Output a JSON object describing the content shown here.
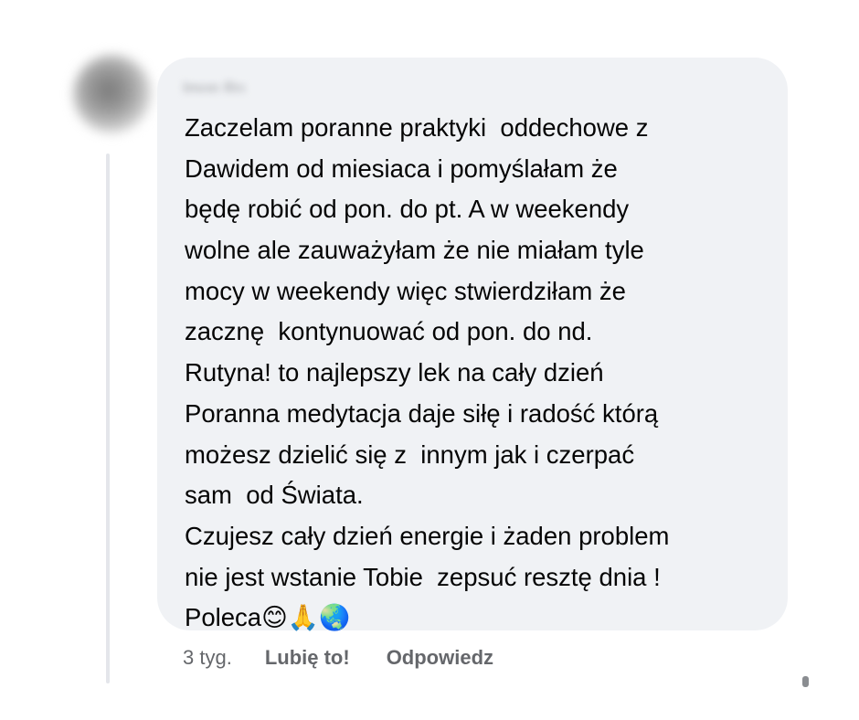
{
  "comment": {
    "author": "Imon Ro",
    "lines": [
      "Zaczelam poranne praktyki  oddechowe z",
      "Dawidem od miesiaca i pomyślałam że",
      "będę robić od pon. do pt. A w weekendy",
      "wolne ale zauważyłam że nie miałam tyle",
      "mocy w weekendy więc stwierdziłam że",
      "zacznę  kontynuować od pon. do nd.",
      "Rutyna! to najlepszy lek na cały dzień",
      "Poranna medytacja daje siłę i radość którą",
      "możesz dzielić się z  innym jak i czerpać",
      "sam  od Świata.",
      "Czujesz cały dzień energie i żaden problem",
      "nie jest wstanie Tobie  zepsuć resztę dnia !"
    ],
    "last_line_text": "Poleca",
    "emojis": [
      "😊",
      "🙏",
      "🌏"
    ]
  },
  "actions": {
    "time": "3 tyg.",
    "like_label": "Lubię to!",
    "reply_label": "Odpowiedz"
  },
  "icons": {
    "avatar": "avatar-blurred",
    "emoji_1": "smiling-face-icon",
    "emoji_2": "folded-hands-icon",
    "emoji_3": "globe-icon"
  }
}
